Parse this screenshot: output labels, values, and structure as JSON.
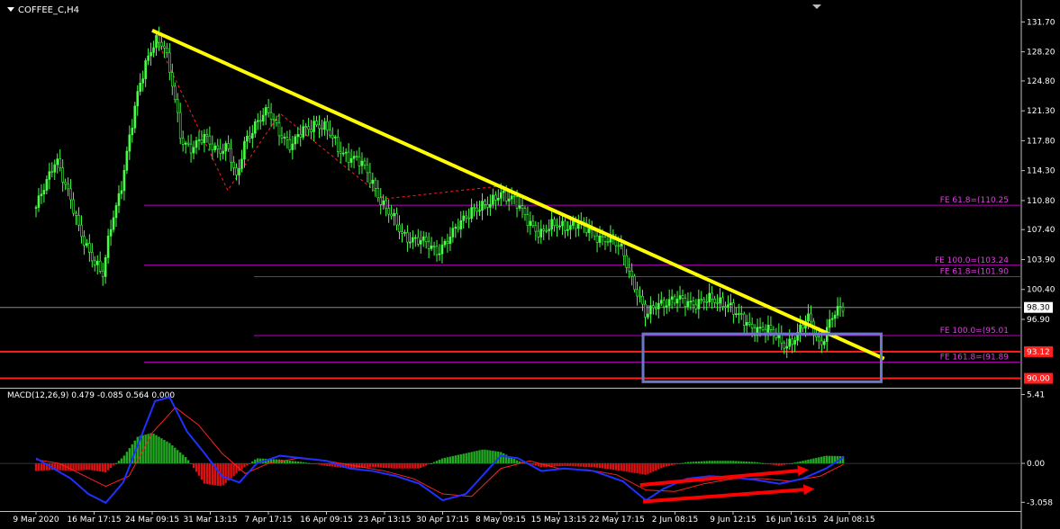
{
  "chart_title": "COFFEE_C,H4",
  "macd_label": "MACD(12,26,9) 0.479 -0.085 0.564 0.000",
  "colors": {
    "background": "#000000",
    "candle": "#44ff44",
    "trendline": "#ffff00",
    "fe_line": "#c000c0",
    "fe_text": "#e040e0",
    "support_line": "#ff2020",
    "box": "#6a78c8",
    "macd_main": "#2030ff",
    "macd_signal": "#ff2020",
    "hist_pos": "#22aa22",
    "hist_neg": "#dd1111",
    "arrow": "#ff0000",
    "price_tag_bg": "#ffffff",
    "grid_axis": "#c0c0c0"
  },
  "chart_data": {
    "type": "candlestick",
    "symbol": "COFFEE_C",
    "timeframe": "H4",
    "y_ticks": [
      "131.70",
      "128.20",
      "124.80",
      "121.30",
      "117.80",
      "114.30",
      "110.80",
      "107.40",
      "103.90",
      "100.40",
      "96.90"
    ],
    "ylim": [
      88.9,
      133.0
    ],
    "x_labels": [
      "9 Mar 2020",
      "16 Mar 17:15",
      "24 Mar 09:15",
      "31 Mar 13:15",
      "7 Apr 17:15",
      "16 Apr 09:15",
      "23 Apr 13:15",
      "30 Apr 17:15",
      "8 May 09:15",
      "15 May 13:15",
      "22 May 17:15",
      "2 Jun 08:15",
      "9 Jun 12:15",
      "16 Jun 16:15",
      "24 Jun 08:15"
    ],
    "price_series": [
      [
        0,
        110
      ],
      [
        0.2,
        113
      ],
      [
        0.35,
        116
      ],
      [
        0.5,
        113
      ],
      [
        0.75,
        107
      ],
      [
        1.0,
        104
      ],
      [
        1.15,
        102
      ],
      [
        1.3,
        108
      ],
      [
        1.45,
        112
      ],
      [
        1.6,
        118
      ],
      [
        1.75,
        123
      ],
      [
        1.9,
        127
      ],
      [
        2.05,
        130
      ],
      [
        2.2,
        129
      ],
      [
        2.35,
        124
      ],
      [
        2.5,
        118
      ],
      [
        2.7,
        117
      ],
      [
        2.9,
        118
      ],
      [
        3.1,
        117
      ],
      [
        3.3,
        117
      ],
      [
        3.45,
        113
      ],
      [
        3.6,
        118
      ],
      [
        3.8,
        120
      ],
      [
        4.0,
        121
      ],
      [
        4.2,
        119
      ],
      [
        4.4,
        117
      ],
      [
        4.6,
        119
      ],
      [
        4.8,
        120
      ],
      [
        5.0,
        119
      ],
      [
        5.2,
        117
      ],
      [
        5.4,
        116
      ],
      [
        5.6,
        115
      ],
      [
        5.8,
        113
      ],
      [
        6.0,
        110
      ],
      [
        6.3,
        107
      ],
      [
        6.6,
        106
      ],
      [
        6.9,
        105
      ],
      [
        7.2,
        107
      ],
      [
        7.5,
        110
      ],
      [
        7.8,
        110
      ],
      [
        8.0,
        112
      ],
      [
        8.2,
        111
      ],
      [
        8.4,
        109
      ],
      [
        8.7,
        107
      ],
      [
        9.0,
        108
      ],
      [
        9.3,
        108
      ],
      [
        9.6,
        107
      ],
      [
        9.9,
        106
      ],
      [
        10.1,
        105
      ],
      [
        10.3,
        101
      ],
      [
        10.5,
        97
      ],
      [
        10.7,
        99
      ],
      [
        11.0,
        99
      ],
      [
        11.3,
        99
      ],
      [
        11.6,
        99
      ],
      [
        11.9,
        99
      ],
      [
        12.1,
        97
      ],
      [
        12.3,
        96
      ],
      [
        12.5,
        96
      ],
      [
        12.7,
        95
      ],
      [
        12.9,
        94
      ],
      [
        13.1,
        95
      ],
      [
        13.3,
        97
      ],
      [
        13.5,
        94
      ],
      [
        13.7,
        97
      ],
      [
        13.9,
        98.3
      ]
    ],
    "current_price": "98.30",
    "trendline": {
      "from": [
        2.0,
        130.7
      ],
      "to": [
        14.6,
        92.3
      ]
    },
    "zigzag": [
      [
        2.05,
        130
      ],
      [
        3.3,
        112
      ],
      [
        4.2,
        121
      ],
      [
        6.0,
        111
      ],
      [
        8.0,
        112.5
      ]
    ],
    "fe_levels": [
      {
        "label": "FE 61.8=(110.25",
        "value": 110.25,
        "x_start": 2.0
      },
      {
        "label": "FE 100.0=(103.24",
        "value": 103.24,
        "x_start": 2.0
      },
      {
        "label": "FE 61.8=(101.90",
        "value": 101.9,
        "x_start": 4.0
      },
      {
        "label": "FE 100.0=(95.01",
        "value": 95.01,
        "x_start": 4.0
      },
      {
        "label": "FE 161.8=(91.89",
        "value": 91.89,
        "x_start": 2.0
      }
    ],
    "support_levels": [
      {
        "label": "93.12",
        "value": 93.12
      },
      {
        "label": "90.00",
        "value": 90.0
      }
    ],
    "box": {
      "x": [
        10.45,
        14.55
      ],
      "y": [
        89.6,
        95.2
      ]
    },
    "macd": {
      "y_ticks": [
        "5.41",
        "0.00",
        "-3.058"
      ],
      "ylim": [
        -3.6,
        5.8
      ],
      "main": [
        [
          0,
          0.4
        ],
        [
          0.3,
          -0.4
        ],
        [
          0.6,
          -1.2
        ],
        [
          0.9,
          -2.4
        ],
        [
          1.2,
          -3.1
        ],
        [
          1.5,
          -1.5
        ],
        [
          1.8,
          2.0
        ],
        [
          2.05,
          4.9
        ],
        [
          2.3,
          5.2
        ],
        [
          2.6,
          2.5
        ],
        [
          2.9,
          0.8
        ],
        [
          3.2,
          -1.0
        ],
        [
          3.5,
          -1.5
        ],
        [
          3.8,
          0.0
        ],
        [
          4.2,
          0.6
        ],
        [
          4.6,
          0.4
        ],
        [
          5.0,
          0.2
        ],
        [
          5.4,
          -0.4
        ],
        [
          5.8,
          -0.6
        ],
        [
          6.2,
          -1.0
        ],
        [
          6.6,
          -1.6
        ],
        [
          7.0,
          -2.9
        ],
        [
          7.4,
          -2.4
        ],
        [
          7.8,
          -0.4
        ],
        [
          8.0,
          0.6
        ],
        [
          8.3,
          0.4
        ],
        [
          8.7,
          -0.6
        ],
        [
          9.1,
          -0.4
        ],
        [
          9.6,
          -0.6
        ],
        [
          10.1,
          -1.4
        ],
        [
          10.5,
          -2.9
        ],
        [
          10.8,
          -2.0
        ],
        [
          11.2,
          -1.2
        ],
        [
          11.6,
          -1.0
        ],
        [
          12.0,
          -1.1
        ],
        [
          12.4,
          -1.3
        ],
        [
          12.8,
          -1.6
        ],
        [
          13.2,
          -1.2
        ],
        [
          13.6,
          -0.4
        ],
        [
          13.9,
          0.48
        ]
      ],
      "signal": [
        [
          0,
          0.3
        ],
        [
          0.4,
          0.0
        ],
        [
          0.8,
          -0.9
        ],
        [
          1.2,
          -1.8
        ],
        [
          1.6,
          -1.0
        ],
        [
          2.0,
          2.4
        ],
        [
          2.4,
          4.4
        ],
        [
          2.8,
          3.0
        ],
        [
          3.2,
          0.8
        ],
        [
          3.6,
          -0.8
        ],
        [
          4.0,
          0.0
        ],
        [
          4.5,
          0.4
        ],
        [
          5.0,
          0.2
        ],
        [
          5.5,
          -0.2
        ],
        [
          6.0,
          -0.6
        ],
        [
          6.5,
          -1.2
        ],
        [
          7.0,
          -2.4
        ],
        [
          7.5,
          -2.6
        ],
        [
          8.0,
          -0.4
        ],
        [
          8.5,
          0.2
        ],
        [
          9.0,
          -0.4
        ],
        [
          9.5,
          -0.5
        ],
        [
          10.0,
          -0.9
        ],
        [
          10.5,
          -2.1
        ],
        [
          11.0,
          -2.2
        ],
        [
          11.5,
          -1.6
        ],
        [
          12.0,
          -1.2
        ],
        [
          12.5,
          -1.2
        ],
        [
          13.0,
          -1.4
        ],
        [
          13.5,
          -1.0
        ],
        [
          13.9,
          -0.08
        ]
      ],
      "hist": [
        [
          0,
          -0.6
        ],
        [
          0.3,
          -0.5
        ],
        [
          0.6,
          -0.6
        ],
        [
          0.9,
          -0.5
        ],
        [
          1.2,
          -0.7
        ],
        [
          1.5,
          0.5
        ],
        [
          1.75,
          2.1
        ],
        [
          2.0,
          2.4
        ],
        [
          2.3,
          1.6
        ],
        [
          2.6,
          0.4
        ],
        [
          2.9,
          -1.6
        ],
        [
          3.2,
          -1.8
        ],
        [
          3.5,
          -0.6
        ],
        [
          3.8,
          0.4
        ],
        [
          4.2,
          0.3
        ],
        [
          4.6,
          0.1
        ],
        [
          5.0,
          -0.2
        ],
        [
          5.4,
          -0.4
        ],
        [
          5.8,
          -0.3
        ],
        [
          6.2,
          -0.4
        ],
        [
          6.6,
          -0.4
        ],
        [
          7.0,
          0.4
        ],
        [
          7.4,
          0.8
        ],
        [
          7.7,
          1.1
        ],
        [
          8.0,
          0.9
        ],
        [
          8.3,
          0.2
        ],
        [
          8.7,
          -0.3
        ],
        [
          9.1,
          -0.2
        ],
        [
          9.6,
          -0.3
        ],
        [
          10.1,
          -0.6
        ],
        [
          10.5,
          -0.9
        ],
        [
          10.8,
          -0.3
        ],
        [
          11.2,
          0.1
        ],
        [
          11.6,
          0.2
        ],
        [
          12.0,
          0.2
        ],
        [
          12.4,
          0.1
        ],
        [
          12.8,
          -0.2
        ],
        [
          13.2,
          0.2
        ],
        [
          13.6,
          0.6
        ],
        [
          13.9,
          0.56
        ]
      ],
      "arrows": [
        {
          "from": [
            10.4,
            -1.7
          ],
          "to": [
            13.3,
            -0.5
          ]
        },
        {
          "from": [
            10.45,
            -3.0
          ],
          "to": [
            13.4,
            -2.0
          ]
        }
      ]
    }
  }
}
